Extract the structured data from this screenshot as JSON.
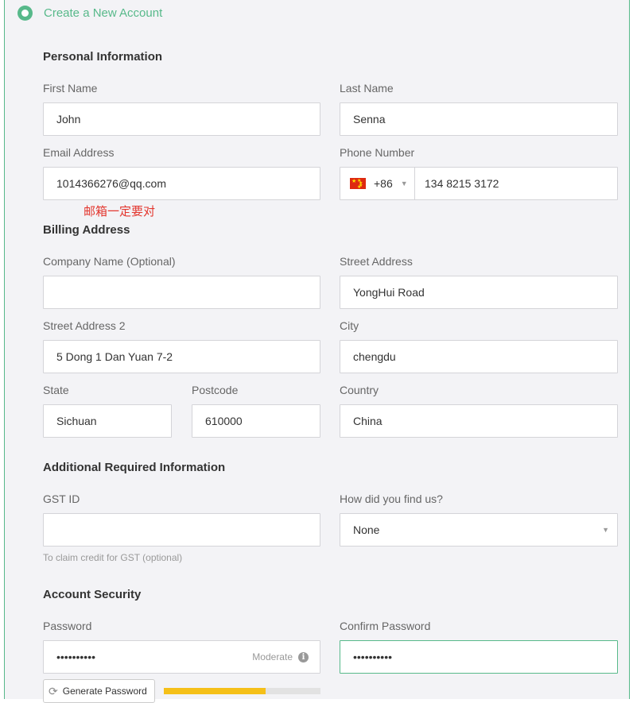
{
  "header": {
    "title": "Create a New Account"
  },
  "sections": {
    "personal": "Personal Information",
    "billing": "Billing Address",
    "additional": "Additional Required Information",
    "security": "Account Security"
  },
  "fields": {
    "first_name": {
      "label": "First Name",
      "value": "John"
    },
    "last_name": {
      "label": "Last Name",
      "value": "Senna"
    },
    "email": {
      "label": "Email Address",
      "value": "1014366276@qq.com"
    },
    "phone": {
      "label": "Phone Number",
      "country_code": "+86",
      "value": "134 8215 3172"
    },
    "company": {
      "label": "Company Name (Optional)",
      "value": ""
    },
    "street": {
      "label": "Street Address",
      "value": "YongHui Road"
    },
    "street2": {
      "label": "Street Address 2",
      "value": "5 Dong 1 Dan Yuan 7-2"
    },
    "city": {
      "label": "City",
      "value": "chengdu"
    },
    "state": {
      "label": "State",
      "value": "Sichuan"
    },
    "postcode": {
      "label": "Postcode",
      "value": "610000"
    },
    "country": {
      "label": "Country",
      "value": "China"
    },
    "gst": {
      "label": "GST ID",
      "value": "",
      "hint": "To claim credit for GST (optional)"
    },
    "find_us": {
      "label": "How did you find us?",
      "value": "None"
    },
    "password": {
      "label": "Password",
      "value": "••••••••••",
      "strength": "Moderate"
    },
    "confirm_password": {
      "label": "Confirm Password",
      "value": "••••••••••"
    }
  },
  "annotation": "邮箱一定要对",
  "generate_button": "Generate Password",
  "strength_level": 0.65,
  "colors": {
    "accent": "#57b98a",
    "warning": "#e3362e",
    "strength_bar": "#f5c019"
  },
  "icons": {
    "flag": "china-flag-icon",
    "info": "info-icon",
    "refresh": "refresh-icon"
  }
}
